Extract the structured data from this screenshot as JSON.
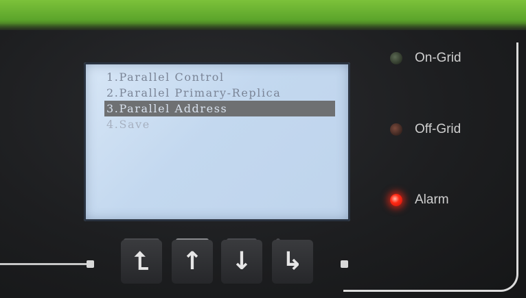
{
  "display": {
    "menu_items": [
      {
        "label": "1.Parallel Control"
      },
      {
        "label": "2.Parallel Primary-Replica"
      },
      {
        "label": "3.Parallel Address"
      },
      {
        "label": "4.Save"
      }
    ],
    "selected_index": 2
  },
  "indicators": [
    {
      "label": "On-Grid",
      "state": "off",
      "color": "#5c6a54"
    },
    {
      "label": "Off-Grid",
      "state": "off",
      "color": "#7a4a3c"
    },
    {
      "label": "Alarm",
      "state": "on",
      "color": "#ff2a14"
    }
  ],
  "keys": [
    {
      "icon": "return-icon",
      "glyph": "⮤"
    },
    {
      "icon": "up-arrow-icon",
      "glyph": "↑"
    },
    {
      "icon": "down-arrow-icon",
      "glyph": "↓"
    },
    {
      "icon": "enter-icon",
      "glyph": "↳"
    }
  ],
  "colors": {
    "lcd_background": "#c9dcf1",
    "lcd_text": "#7a8496",
    "selection_bar": "#6e7072",
    "panel": "#1d1e20",
    "accent_green": "#6cb832"
  }
}
